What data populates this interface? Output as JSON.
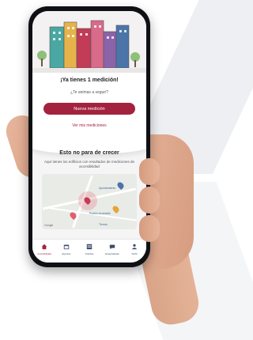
{
  "brand": {
    "accent": "#a3233f",
    "nav_icon_color": "#3a4a6b",
    "map_pin_color": "#e05d6f"
  },
  "hero": {
    "title": "¡Ya tienes 1 medición!",
    "subtitle": "¿Te animas a seguir?"
  },
  "actions": {
    "primary_label": "Nueva medición",
    "secondary_label": "Ver mis mediciones"
  },
  "growth": {
    "title": "Esto no para de crecer",
    "description": "Aquí tienes los edificios con resultados de mediciones de accesibilidad"
  },
  "map": {
    "places": [
      "Ayuntamiento",
      "Pueblo Accesible",
      "Tienda"
    ],
    "attribution": "Google"
  },
  "nav": {
    "items": [
      {
        "label": "Accesibilidad",
        "icon": "home-icon",
        "active": true
      },
      {
        "label": "Eventos",
        "icon": "calendar-icon",
        "active": false
      },
      {
        "label": "Noticias",
        "icon": "news-icon",
        "active": false
      },
      {
        "label": "Especialistas",
        "icon": "chat-icon",
        "active": false
      },
      {
        "label": "Perfil",
        "icon": "user-icon",
        "active": false
      }
    ]
  }
}
